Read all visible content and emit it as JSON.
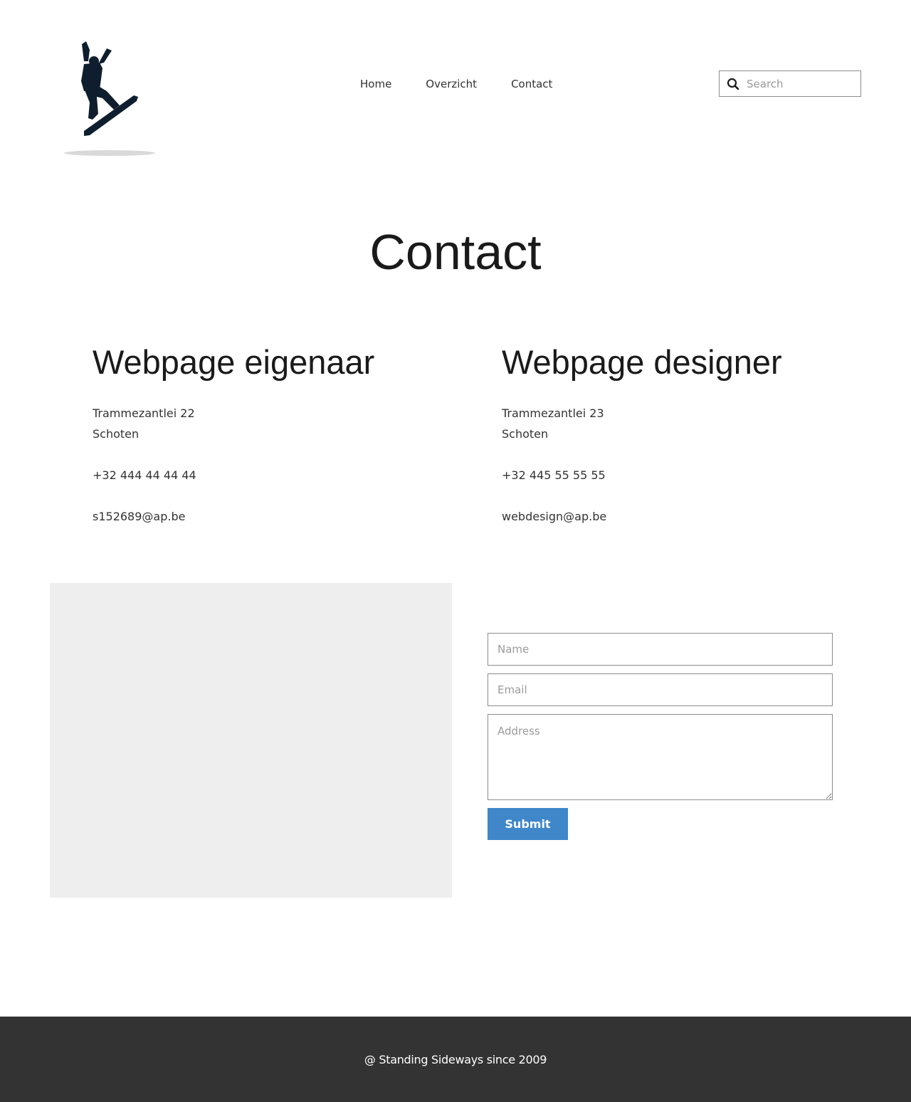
{
  "header": {
    "logo_icon": "snowboarder-logo-icon",
    "nav": [
      {
        "label": "Home"
      },
      {
        "label": "Overzicht"
      },
      {
        "label": "Contact"
      }
    ],
    "search": {
      "placeholder": "Search",
      "value": "",
      "icon": "search-icon"
    }
  },
  "main": {
    "title": "Contact",
    "owner": {
      "heading": "Webpage eigenaar",
      "street": "Trammezantlei 22",
      "city": "Schoten",
      "phone": "+32 444 44 44 44",
      "email": "s152689@ap.be"
    },
    "designer": {
      "heading": "Webpage designer",
      "street": "Trammezantlei 23",
      "city": "Schoten",
      "phone": "+32 445 55 55 55",
      "email": "webdesign@ap.be"
    },
    "form": {
      "name_placeholder": "Name",
      "email_placeholder": "Email",
      "address_placeholder": "Address",
      "submit_label": "Submit"
    }
  },
  "footer": {
    "text": "@ Standing Sideways since 2009"
  },
  "colors": {
    "accent": "#3f87c9",
    "footer_bg": "#333333",
    "map_placeholder": "#eeeeee"
  }
}
